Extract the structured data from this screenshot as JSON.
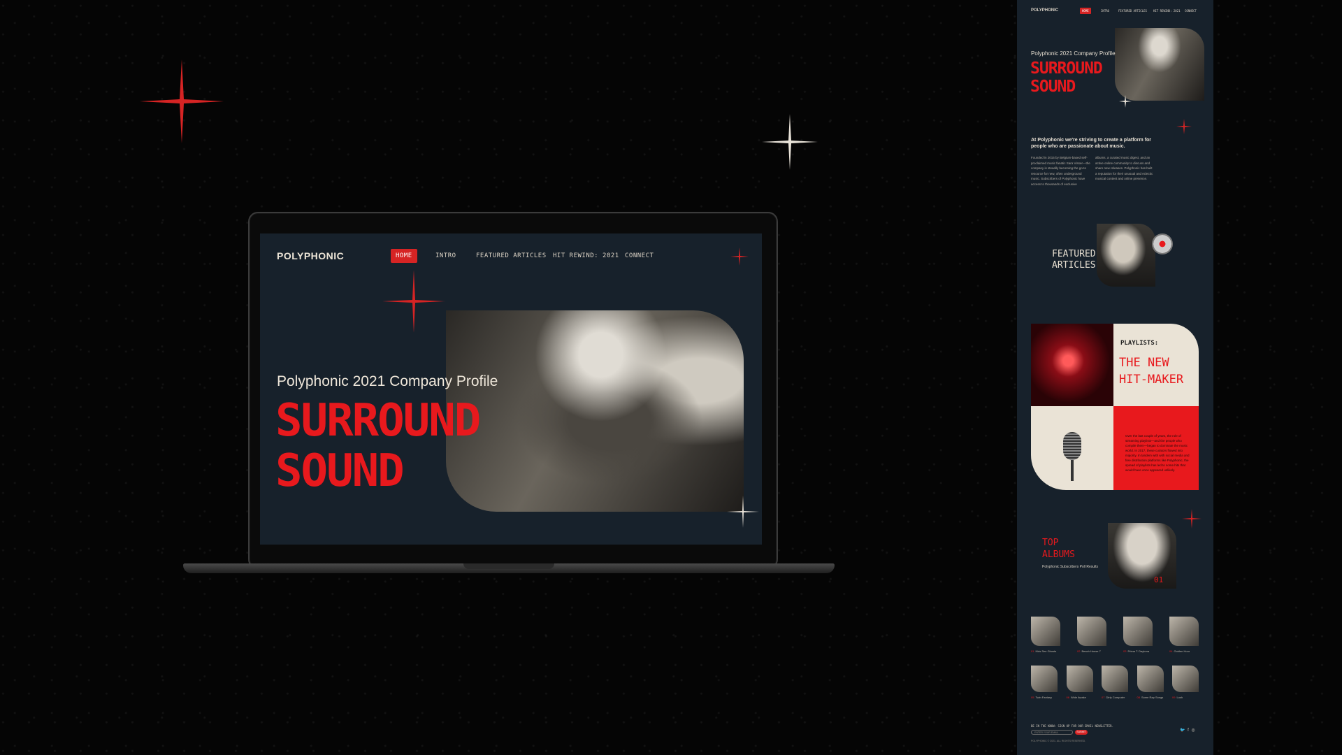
{
  "desktop": {
    "nav": {
      "logo": "POLYPHONIC",
      "items": [
        "HOME",
        "INTRO",
        "FEATURED ARTICLES",
        "HIT REWIND: 2021",
        "CONNECT"
      ]
    },
    "hero": {
      "subtitle": "Polyphonic 2021 Company Profile",
      "title_line1": "SURROUND",
      "title_line2": "SOUND"
    }
  },
  "mobile": {
    "nav": {
      "logo": "POLYPHONIC",
      "items": [
        "HOME",
        "INTRO",
        "FEATURED ARTICLES",
        "HIT REWIND: 2021",
        "CONNECT"
      ]
    },
    "hero": {
      "subtitle": "Polyphonic 2021 Company Profile",
      "title_line1": "SURROUND",
      "title_line2": "SOUND"
    },
    "intro": {
      "lead": "At Polyphonic we're striving to create a platform for people who are passionate about music.",
      "col1": "Founded in 2015 by Belgium-based self-proclaimed music fanatic Sara Visser—the company is steadily becoming the go-to resource for new, often underground music. Subscribers of Polyphonic have access to thousands of exclusive",
      "col2": "albums, a curated music digest, and an active online community to discuss and share new releases. Polyphonic has built a reputation for their unusual and eclectic musical content and online presence."
    },
    "featured": {
      "line1": "FEATURED",
      "line2": "ARTICLES"
    },
    "playlists": {
      "label": "PLAYLISTS:",
      "title_line1": "THE NEW",
      "title_line2": "HIT-MAKER",
      "body": "Over the last couple of years, the role of streaming playlists—and the people who compile them—began to dominate the music world. In 2017, these curators flowed into majority. In tandem with with social media and free distribution platforms like Polyphonic, the spread of playlists has led to some hits that would have once appeared unlikely."
    },
    "top_albums": {
      "line1": "TOP",
      "line2": "ALBUMS",
      "subtitle": "Polyphonic Subscribers Poll Results",
      "number": "01"
    },
    "albums_row1": [
      {
        "num": "01",
        "title": "Kids See Ghosts"
      },
      {
        "num": "02",
        "title": "Beach House 7"
      },
      {
        "num": "03",
        "title": "Prima T. Daytona"
      },
      {
        "num": "04",
        "title": "Golden Hour"
      }
    ],
    "albums_row2": [
      {
        "num": "05",
        "title": "Twin Fantasy"
      },
      {
        "num": "06",
        "title": "Wide Awake"
      },
      {
        "num": "07",
        "title": "Dirty Computer"
      },
      {
        "num": "08",
        "title": "Some Rap Songs"
      },
      {
        "num": "09",
        "title": "Lush"
      }
    ],
    "footer": {
      "newsletter": "BE IN THE KNOW: SIGN UP FOR OUR EMAIL NEWSLETTER.",
      "email_placeholder": "ENTER YOUR EMAIL",
      "submit": "SUBMIT",
      "copyright": "POLYPHONIC © 2021. ALL RIGHTS RESERVED.",
      "social": "🐦 f ◎"
    }
  },
  "colors": {
    "accent": "#e8191d",
    "bg": "#17212b",
    "cream": "#eae3d6"
  }
}
